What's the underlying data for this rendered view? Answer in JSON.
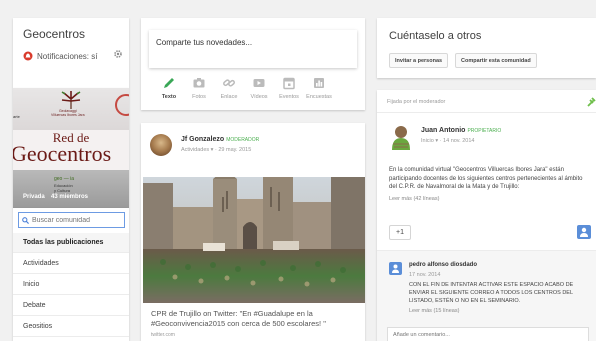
{
  "sidebar": {
    "community_name": "Geocentros",
    "notifications_label": "Notificaciones: sí",
    "banner": {
      "edge_text": "arte",
      "subtitle_line1": "Geolavaggi",
      "subtitle_line2": "Villuercas Ibores Jara",
      "title_line1": "Red de",
      "title_line2": "Geocentros",
      "logo_text": "geo — ia",
      "sub_text_line1": "Educación",
      "sub_text_line2": "y Cultura",
      "privacy": "Privada",
      "members": "43 miembros"
    },
    "search_placeholder": "Buscar comunidad",
    "nav_items": [
      {
        "label": "Todas las publicaciones"
      },
      {
        "label": "Actividades"
      },
      {
        "label": "Inicio"
      },
      {
        "label": "Debate"
      },
      {
        "label": "Geositios"
      }
    ]
  },
  "share": {
    "placeholder": "Comparte tus novedades...",
    "options": [
      {
        "label": "Texto",
        "icon": "pencil-icon"
      },
      {
        "label": "Fotos",
        "icon": "camera-icon"
      },
      {
        "label": "Enlace",
        "icon": "link-icon"
      },
      {
        "label": "Vídeos",
        "icon": "video-icon"
      },
      {
        "label": "Eventos",
        "icon": "calendar-icon"
      },
      {
        "label": "Encuestas",
        "icon": "poll-icon"
      }
    ]
  },
  "post": {
    "author": "Jf Gonzalezo",
    "badge": "MODERADOR",
    "category": "Actividades",
    "date": "29 may. 2015",
    "text": "CPR de Trujillo on Twitter: \"En #Guadalupe en la #Geoconvivencia2015 con cerca de 500 escolares! \"",
    "link": "twitter.com"
  },
  "invite": {
    "title": "Cuéntaselo a otros",
    "invite_people_label": "Invitar a personas",
    "share_community_label": "Compartir esta comunidad"
  },
  "pinned": {
    "label": "Fijada por el moderador",
    "author": "Juan Antonio",
    "badge": "PROPIETARIO",
    "category": "Inicio",
    "date": "14 nov. 2014",
    "body": "En la comunidad virtual \"Geocentros Villuercas Ibores Jara\" están participando docentes de los siguientes centros pertenecientes al ámbito del C.P.R. de Navalmoral de la Mata y de Trujillo:",
    "read_more": "Leer más (42 líneas)",
    "plus_one": "+1",
    "comment": {
      "author": "pedro alfonso diosdado",
      "date": "17 nov. 2014",
      "body": "CON EL FIN DE INTENTAR ACTIVAR ESTE ESPACIO ACABO DE ENVIAR EL SIGUIENTE CORREO A TODOS LOS CENTROS DEL LISTADO, ESTÉN O NO EN EL SEMINARIO.",
      "read_more": "Leer más (15 líneas)"
    },
    "comment_placeholder": "Añade un comentario..."
  },
  "colors": {
    "background": "#f1f1f1",
    "moderator_badge": "#4caf50",
    "banner_title": "#6b1a16",
    "search_border": "#6d9be3"
  }
}
